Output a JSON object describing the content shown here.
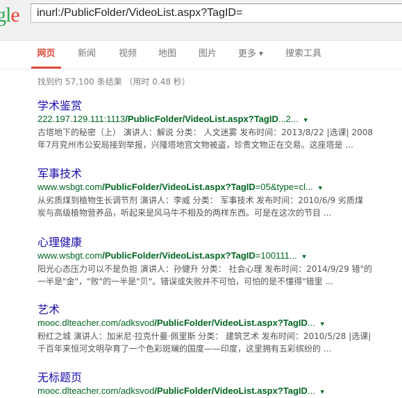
{
  "search": {
    "query": "inurl:/PublicFolder/VideoList.aspx?TagID="
  },
  "logo": {
    "letters": [
      "g",
      "l",
      "e"
    ]
  },
  "tabs": [
    {
      "label": "网页"
    },
    {
      "label": "新闻"
    },
    {
      "label": "视频"
    },
    {
      "label": "地图"
    },
    {
      "label": "图片"
    },
    {
      "label": "更多"
    },
    {
      "label": "搜索工具"
    }
  ],
  "stats": "找到约 57,100 条结果 （用时 0.48 秒）",
  "results": [
    {
      "title": "学术鉴赏",
      "url_prefix": "222.197.129.111:1113",
      "url_bold": "/PublicFolder/VideoList.aspx?TagID",
      "url_suffix": "...2...",
      "snippet1": "古塔地下的秘密（上） 演讲人：解说 分类： 人文迷雾 发布时间：2013/8/22 |选课| 2008",
      "snippet2": "年7月兖州市公安局接到举报，兴隆塔地宫文物被盗，珍贵文物正在交易。这座塔是 ..."
    },
    {
      "title": "军事技术",
      "url_prefix": "www.wsbgt.com",
      "url_bold": "/PublicFolder/VideoList.aspx?TagID",
      "url_suffix": "=05&type=cl...",
      "snippet1": "从劣质煤到植物生长调节剂 演讲人：李威 分类： 军事技术 发布时间：2010/6/9 劣质煤",
      "snippet2": "炭与高级植物营养品，听起来是风马牛不相及的两样东西。可是在这次的节目 ..."
    },
    {
      "title": "心理健康",
      "url_prefix": "www.wsbgt.com",
      "url_bold": "/PublicFolder/VideoList.aspx?TagID",
      "url_suffix": "=100111...",
      "snippet1": "阳光心态压力可以不是负担 演讲人：孙健升 分类： 社会心理 发布时间：2014/9/29 错\"的",
      "snippet2": "一半是\"金\"，\"败\"的一半是\"贝\"。错误或失败并不可怕，可怕的是不懂得\"错里 ..."
    },
    {
      "title": "艺术",
      "url_prefix": "mooc.dlteacher.com/adksvod",
      "url_bold": "/PublicFolder/VideoList.aspx?TagID",
      "url_suffix": "...",
      "snippet1": "粉红之城 演讲人：加米尼·拉克什曼·佩里斯 分类： 建筑艺术 发布时间：2010/5/28 |选课|",
      "snippet2": "千百年来恒河文明孕育了一个色彩斑斓的国度——印度，这里拥有五彩缤纷的 ..."
    },
    {
      "title": "无标题页",
      "url_prefix": "mooc.dlteacher.com/adksvod",
      "url_bold": "/PublicFolder/VideoList.aspx?TagID",
      "url_suffix": "...",
      "snippet1": "",
      "snippet2": ""
    }
  ]
}
